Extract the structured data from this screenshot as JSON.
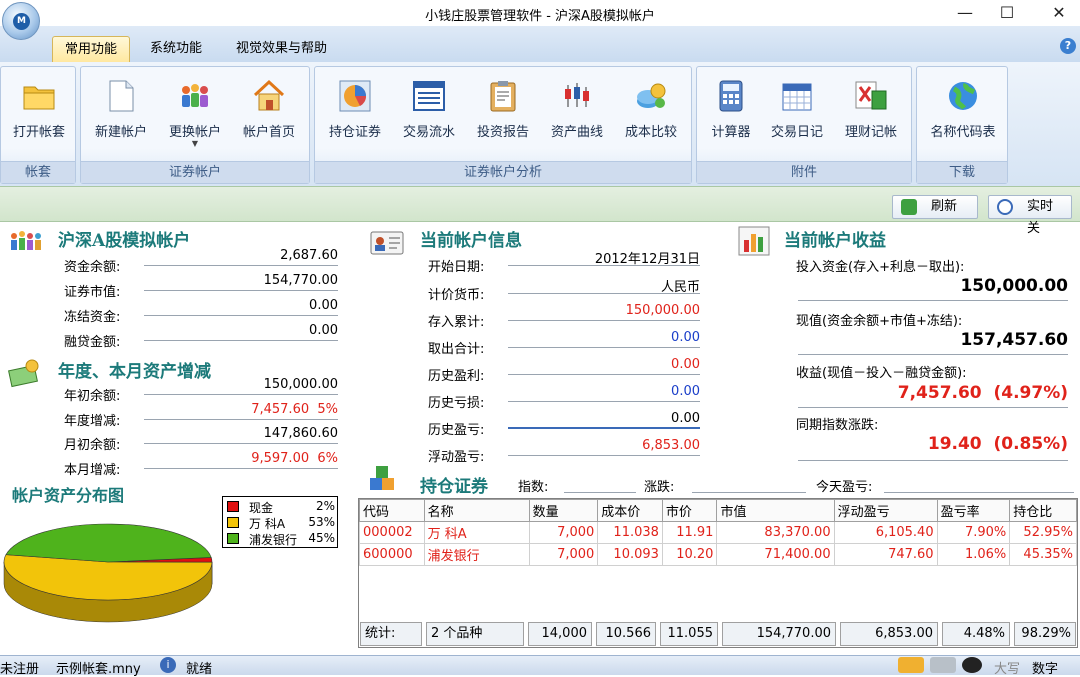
{
  "window": {
    "title": "小钱庄股票管理软件 - 沪深A股模拟帐户"
  },
  "tabs": [
    {
      "label": "常用功能",
      "active": true
    },
    {
      "label": "系统功能",
      "active": false
    },
    {
      "label": "视觉效果与帮助",
      "active": false
    }
  ],
  "ribbon": {
    "groups": [
      {
        "label": "帐套",
        "buttons": [
          {
            "label": "打开帐套",
            "icon": "folder-icon"
          }
        ]
      },
      {
        "label": "证券帐户",
        "buttons": [
          {
            "label": "新建帐户",
            "icon": "new-document-icon"
          },
          {
            "label": "更换帐户",
            "icon": "users-icon"
          },
          {
            "label": "帐户首页",
            "icon": "home-icon"
          }
        ]
      },
      {
        "label": "证券帐户分析",
        "buttons": [
          {
            "label": "持仓证券",
            "icon": "pie-chart-icon"
          },
          {
            "label": "交易流水",
            "icon": "list-table-icon"
          },
          {
            "label": "投资报告",
            "icon": "clipboard-icon"
          },
          {
            "label": "资产曲线",
            "icon": "candlestick-icon"
          },
          {
            "label": "成本比较",
            "icon": "coins-icon"
          }
        ]
      },
      {
        "label": "附件",
        "buttons": [
          {
            "label": "计算器",
            "icon": "calculator-icon"
          },
          {
            "label": "交易日记",
            "icon": "calendar-icon"
          },
          {
            "label": "理财记帐",
            "icon": "ledger-icon"
          }
        ]
      },
      {
        "label": "下载",
        "buttons": [
          {
            "label": "名称代码表",
            "icon": "globe-icon"
          }
        ]
      }
    ]
  },
  "toolbar": {
    "refresh_label": "刷新",
    "realtime_label": "实时关"
  },
  "account": {
    "title": "沪深A股模拟帐户",
    "rows": [
      {
        "label": "资金余额:",
        "value": "2,687.60"
      },
      {
        "label": "证券市值:",
        "value": "154,770.00"
      },
      {
        "label": "冻结资金:",
        "value": "0.00"
      },
      {
        "label": "融贷金额:",
        "value": "0.00"
      }
    ]
  },
  "annual": {
    "title": "年度、本月资产增减",
    "rows": [
      {
        "label": "年初余额:",
        "value": "150,000.00",
        "color": "black"
      },
      {
        "label": "年度增减:",
        "value": "7,457.60  5%",
        "color": "red"
      },
      {
        "label": "月初余额:",
        "value": "147,860.60",
        "color": "black"
      },
      {
        "label": "本月增减:",
        "value": "9,597.00  6%",
        "color": "red"
      }
    ]
  },
  "info": {
    "title": "当前帐户信息",
    "rows": [
      {
        "label": "开始日期:",
        "value": "2012年12月31日",
        "color": "black"
      },
      {
        "label": "计价货币:",
        "value": "人民币",
        "color": "black"
      },
      {
        "label": "存入累计:",
        "value": "150,000.00",
        "color": "red"
      },
      {
        "label": "取出合计:",
        "value": "0.00",
        "color": "blue"
      },
      {
        "label": "历史盈利:",
        "value": "0.00",
        "color": "red"
      },
      {
        "label": "历史亏损:",
        "value": "0.00",
        "color": "blue"
      },
      {
        "label": "历史盈亏:",
        "value": "0.00",
        "color": "black"
      },
      {
        "label": "浮动盈亏:",
        "value": "6,853.00",
        "color": "red"
      }
    ]
  },
  "income": {
    "title": "当前帐户收益",
    "items": [
      {
        "label": "投入资金(存入+利息－取出):",
        "value": "150,000.00",
        "color": "black"
      },
      {
        "label": "现值(资金余额+市值+冻结):",
        "value": "157,457.60",
        "color": "black"
      },
      {
        "label": "收益(现值－投入－融贷金额):",
        "value": "7,457.60  (4.97%)",
        "color": "red"
      },
      {
        "label": "同期指数涨跌:",
        "value": "19.40  (0.85%)",
        "color": "red"
      }
    ]
  },
  "distribution": {
    "title": "帐户资产分布图",
    "legend": [
      {
        "name": "现金",
        "pct": "2%",
        "color": "#e01010",
        "value": 2
      },
      {
        "name": "万 科A",
        "pct": "53%",
        "color": "#f2c40a",
        "value": 53
      },
      {
        "name": "浦发银行",
        "pct": "45%",
        "color": "#4fb31c",
        "value": 45
      }
    ]
  },
  "holdings": {
    "title": "持仓证券",
    "index_label": "指数:",
    "change_label": "涨跌:",
    "today_label": "今天盈亏:",
    "columns": [
      "代码",
      "名称",
      "数量",
      "成本价",
      "市价",
      "市值",
      "浮动盈亏",
      "盈亏率",
      "持仓比"
    ],
    "rows": [
      [
        "000002",
        "万 科A",
        "7,000",
        "11.038",
        "11.91",
        "83,370.00",
        "6,105.40",
        "7.90%",
        "52.95%"
      ],
      [
        "600000",
        "浦发银行",
        "7,000",
        "10.093",
        "10.20",
        "71,400.00",
        "747.60",
        "1.06%",
        "45.35%"
      ]
    ],
    "totals": [
      "统计:",
      "2 个品种",
      "14,000",
      "10.566",
      "11.055",
      "154,770.00",
      "6,853.00",
      "4.48%",
      "98.29%"
    ]
  },
  "status": {
    "reg": "未注册",
    "file": "示例帐套.mny",
    "ready": "就绪",
    "caps": "大写",
    "num": "数字"
  }
}
